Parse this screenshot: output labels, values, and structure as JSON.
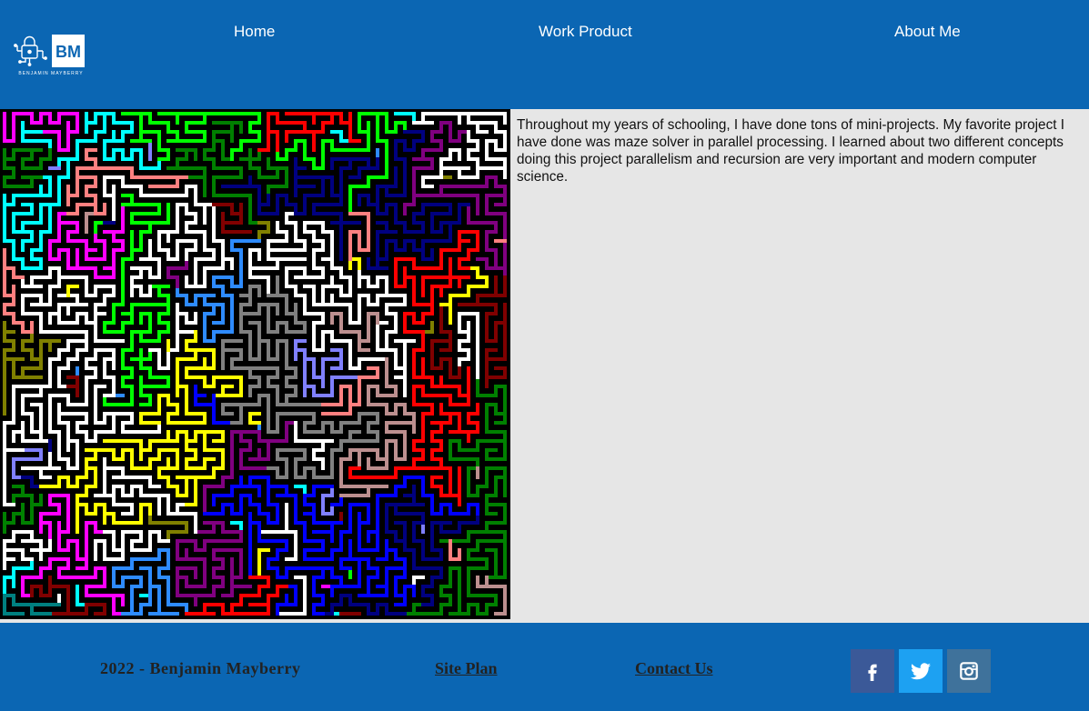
{
  "header": {
    "logo": {
      "initials": "BM",
      "caption": "BENJAMIN MAYBERRY"
    },
    "nav": [
      {
        "label": "Home"
      },
      {
        "label": "Work Product"
      },
      {
        "label": "About Me"
      }
    ]
  },
  "main": {
    "image": {
      "icon": "maze-image"
    },
    "paragraph": "Throughout my years of schooling, I have done tons of mini-projects. My favorite project I have done was maze solver in parallel processing. I learned about two different concepts doing this project parallelism and recursion are very important and modern computer science."
  },
  "footer": {
    "copyright": "2022 - Benjamin Mayberry",
    "site_plan": "Site Plan",
    "contact_us": "Contact Us",
    "social": [
      {
        "icon": "facebook-icon"
      },
      {
        "icon": "twitter-icon"
      },
      {
        "icon": "instagram-icon"
      }
    ]
  },
  "colors": {
    "brand_blue": "#0b66b3",
    "content_bg": "#e6e6e6",
    "facebook": "#3b5998",
    "twitter": "#1da1f2",
    "instagram": "#3f729b"
  }
}
